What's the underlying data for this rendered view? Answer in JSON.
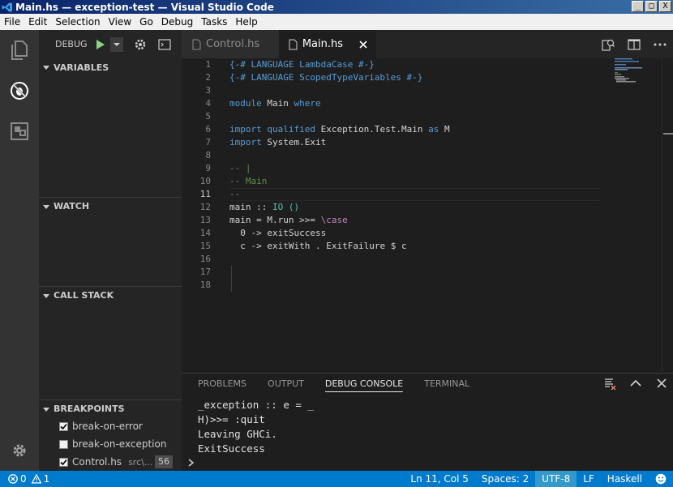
{
  "window": {
    "title": "Main.hs — exception-test — Visual Studio Code",
    "minimize": "_",
    "maximize": "□",
    "close": "X"
  },
  "menu": [
    "File",
    "Edit",
    "Selection",
    "View",
    "Go",
    "Debug",
    "Tasks",
    "Help"
  ],
  "debug_toolbar": {
    "label": "DEBUG"
  },
  "sidebar": {
    "sections": {
      "variables": "VARIABLES",
      "watch": "WATCH",
      "call_stack": "CALL STACK",
      "breakpoints": "BREAKPOINTS"
    },
    "breakpoints": [
      {
        "label": "break-on-error",
        "checked": true
      },
      {
        "label": "break-on-exception",
        "checked": false
      },
      {
        "label": "Control.hs",
        "path": "src\\...",
        "line": "56",
        "checked": true
      }
    ]
  },
  "tabs": [
    {
      "label": "Control.hs",
      "active": false
    },
    {
      "label": "Main.hs",
      "active": true
    }
  ],
  "editor": {
    "line_numbers": [
      "1",
      "2",
      "3",
      "4",
      "5",
      "6",
      "7",
      "8",
      "9",
      "10",
      "11",
      "12",
      "13",
      "14",
      "15",
      "16",
      "17",
      "18"
    ],
    "lines": [
      "{-# LANGUAGE LambdaCase #-}",
      "{-# LANGUAGE ScopedTypeVariables #-}",
      "",
      "module Main where",
      "",
      "import qualified Exception.Test.Main as M",
      "import System.Exit",
      "",
      "-- |",
      "-- Main",
      "--",
      "main :: IO ()",
      "main = M.run >>= \\case",
      "  0 -> exitSuccess",
      "  c -> exitWith . ExitFailure $ c",
      "",
      "",
      ""
    ]
  },
  "panel": {
    "tabs": [
      "PROBLEMS",
      "OUTPUT",
      "DEBUG CONSOLE",
      "TERMINAL"
    ],
    "active_tab": "DEBUG CONSOLE",
    "console_lines": [
      "_exception :: e = _",
      "H)>>= :quit",
      "Leaving GHCi.",
      "ExitSuccess"
    ],
    "prompt": "›"
  },
  "status": {
    "errors": "0",
    "warnings": "1",
    "position": "Ln 11, Col 5",
    "spaces": "Spaces: 2",
    "encoding": "UTF-8",
    "eol": "LF",
    "language": "Haskell"
  },
  "colors": {
    "accent": "#007acc",
    "keyword": "#569cd6",
    "comment": "#608b4e",
    "text": "#d4d4d4"
  }
}
